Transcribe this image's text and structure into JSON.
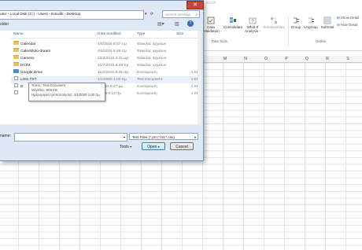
{
  "excel": {
    "title": "Excel",
    "ribbon": {
      "data_validation": "Data\nValidation -",
      "consolidate": "Consolidate",
      "what_if": "What-If\nAnalysis -",
      "relationships": "Relationships",
      "group": "Group",
      "ungroup": "Ungroup",
      "subtotal": "Subtotal",
      "show_detail": "Show Detail",
      "hide_detail": "Hide Detail",
      "group_data_tools": "Data Tools",
      "group_outline": "Outline"
    },
    "columns": [
      "M",
      "N",
      "O",
      "P",
      "Q",
      "R",
      "S"
    ]
  },
  "dialog": {
    "breadcrumb": "uter › Local Disk (C:) › Users › Eduvilk › Desktop",
    "search_placeholder": "Search Desktop",
    "nav_label": "older",
    "headers": {
      "name": "Name",
      "date": "Date modified",
      "type": "Type",
      "size": "Size"
    },
    "rows": [
      {
        "icon": "folder",
        "name": "Calendar",
        "date": "4/5/2015 8:57 πμ",
        "type": "Φάκελος αρχείων",
        "size": ""
      },
      {
        "icon": "folder",
        "name": "CalenMolo-draam",
        "date": "4/5/2015 8:48 πμ",
        "type": "Φάκελος αρχείων",
        "size": ""
      },
      {
        "icon": "folder",
        "name": "Camera",
        "date": "23/3/2015 2:41 μμ",
        "type": "Φάκελος αρχείων",
        "size": ""
      },
      {
        "icon": "folder",
        "name": "DCIM",
        "date": "10/7/2015 8:49 πμ",
        "type": "Φάκελος αρχείων",
        "size": ""
      },
      {
        "icon": "gdrive",
        "name": "Google Drive",
        "date": "11/2/2016 8:49 πμ",
        "type": "Συντόμευση",
        "size": "1 KB"
      },
      {
        "icon": "doc",
        "name": "LOG.TXT",
        "date": "1/1/2000 1:00 πμ",
        "type": "Text Document",
        "size": "1 KB"
      },
      {
        "icon": "doc",
        "name": "E",
        "date": "1/2014 5:47 μμ",
        "type": "Συντόμευση",
        "size": "2 KB"
      },
      {
        "icon": "doc",
        "name": "",
        "date": "/2015 9:13 πμ",
        "type": "Συντόμευση",
        "size": "1 KB"
      }
    ],
    "tooltip": {
      "line1": "Τύπος: Text Document",
      "line2": "Μέγεθος: 606 KB",
      "line3": "Ημερομηνία τροποποίησης: 1/1/2000 1:00 πμ"
    },
    "filename_label": "name:",
    "filename_value": "",
    "filetype": "Text Files (*.prn;*.txt;*.csv)",
    "tools_label": "Tools",
    "open_label": "Open",
    "cancel_label": "Cancel"
  }
}
